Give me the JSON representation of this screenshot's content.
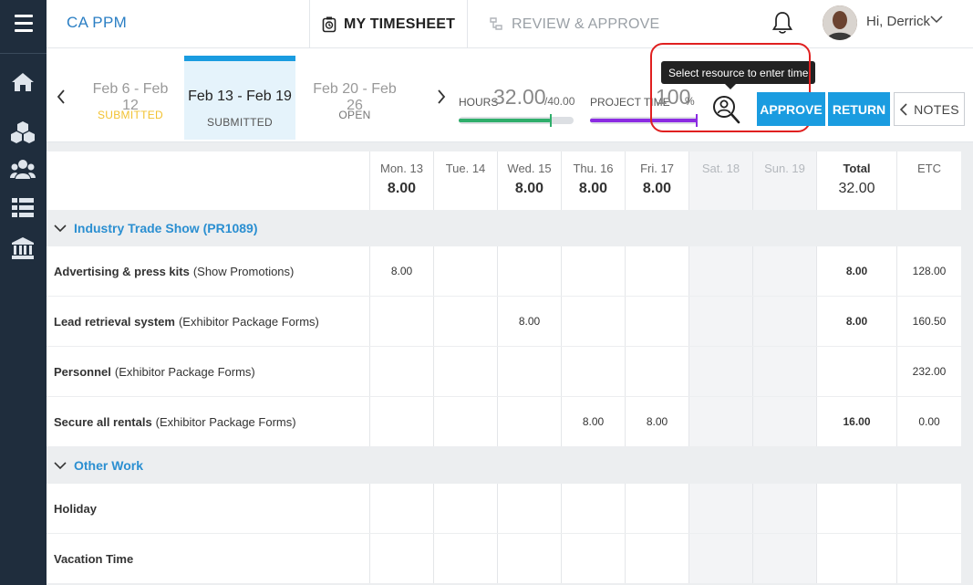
{
  "app": {
    "brand": "CA PPM"
  },
  "nav": {
    "my_timesheet": "MY TIMESHEET",
    "review_approve": "REVIEW & APPROVE",
    "greeting": "Hi, Derrick"
  },
  "weeks": [
    {
      "dates": "Feb 6 - Feb 12",
      "status": "SUBMITTED"
    },
    {
      "dates": "Feb 13 - Feb 19",
      "status": "SUBMITTED"
    },
    {
      "dates": "Feb 20 - Feb 26",
      "status": "OPEN"
    }
  ],
  "summary": {
    "hours_label": "HOURS",
    "hours_value": "32.00",
    "hours_of": "/40.00",
    "hours_fraction": 0.8,
    "project_time_label": "PROJECT TIME",
    "project_time_value": "100",
    "project_time_unit": "%",
    "project_time_fraction": 1.0
  },
  "toolbar": {
    "tooltip": "Select resource to enter time",
    "approve": "APPROVE",
    "return": "RETURN",
    "notes": "NOTES"
  },
  "colors": {
    "accent": "#1a9ce0",
    "brand": "#2b7fc4",
    "submitted_prior": "#f2c230",
    "hours_bar": "#2fae6b",
    "project_bar": "#8b2be2",
    "highlight": "#e02020"
  },
  "columns": [
    {
      "day": "Mon. 13",
      "total": "8.00",
      "weekend": false
    },
    {
      "day": "Tue. 14",
      "total": "",
      "weekend": false
    },
    {
      "day": "Wed. 15",
      "total": "8.00",
      "weekend": false
    },
    {
      "day": "Thu. 16",
      "total": "8.00",
      "weekend": false
    },
    {
      "day": "Fri. 17",
      "total": "8.00",
      "weekend": false
    },
    {
      "day": "Sat. 18",
      "total": "",
      "weekend": true
    },
    {
      "day": "Sun. 19",
      "total": "",
      "weekend": true
    },
    {
      "day": "Total",
      "total": "32.00",
      "kind": "total"
    },
    {
      "day": "ETC",
      "total": "",
      "kind": "etc"
    }
  ],
  "groups": [
    {
      "name": "Industry Trade Show (PR1089)",
      "rows": [
        {
          "task": "Advertising & press kits",
          "sub": "(Show Promotions)",
          "cells": [
            "8.00",
            "",
            "",
            "",
            "",
            "",
            "",
            "8.00",
            "128.00"
          ]
        },
        {
          "task": "Lead retrieval system",
          "sub": "(Exhibitor Package Forms)",
          "cells": [
            "",
            "",
            "8.00",
            "",
            "",
            "",
            "",
            "8.00",
            "160.50"
          ]
        },
        {
          "task": "Personnel",
          "sub": "(Exhibitor Package Forms)",
          "cells": [
            "",
            "",
            "",
            "",
            "",
            "",
            "",
            "",
            "232.00"
          ]
        },
        {
          "task": "Secure all rentals",
          "sub": "(Exhibitor Package Forms)",
          "cells": [
            "",
            "",
            "",
            "8.00",
            "8.00",
            "",
            "",
            "16.00",
            "0.00"
          ]
        }
      ]
    },
    {
      "name": "Other Work",
      "rows": [
        {
          "task": "Holiday",
          "sub": "",
          "cells": [
            "",
            "",
            "",
            "",
            "",
            "",
            "",
            "",
            ""
          ]
        },
        {
          "task": "Vacation Time",
          "sub": "",
          "cells": [
            "",
            "",
            "",
            "",
            "",
            "",
            "",
            "",
            ""
          ]
        }
      ]
    }
  ]
}
